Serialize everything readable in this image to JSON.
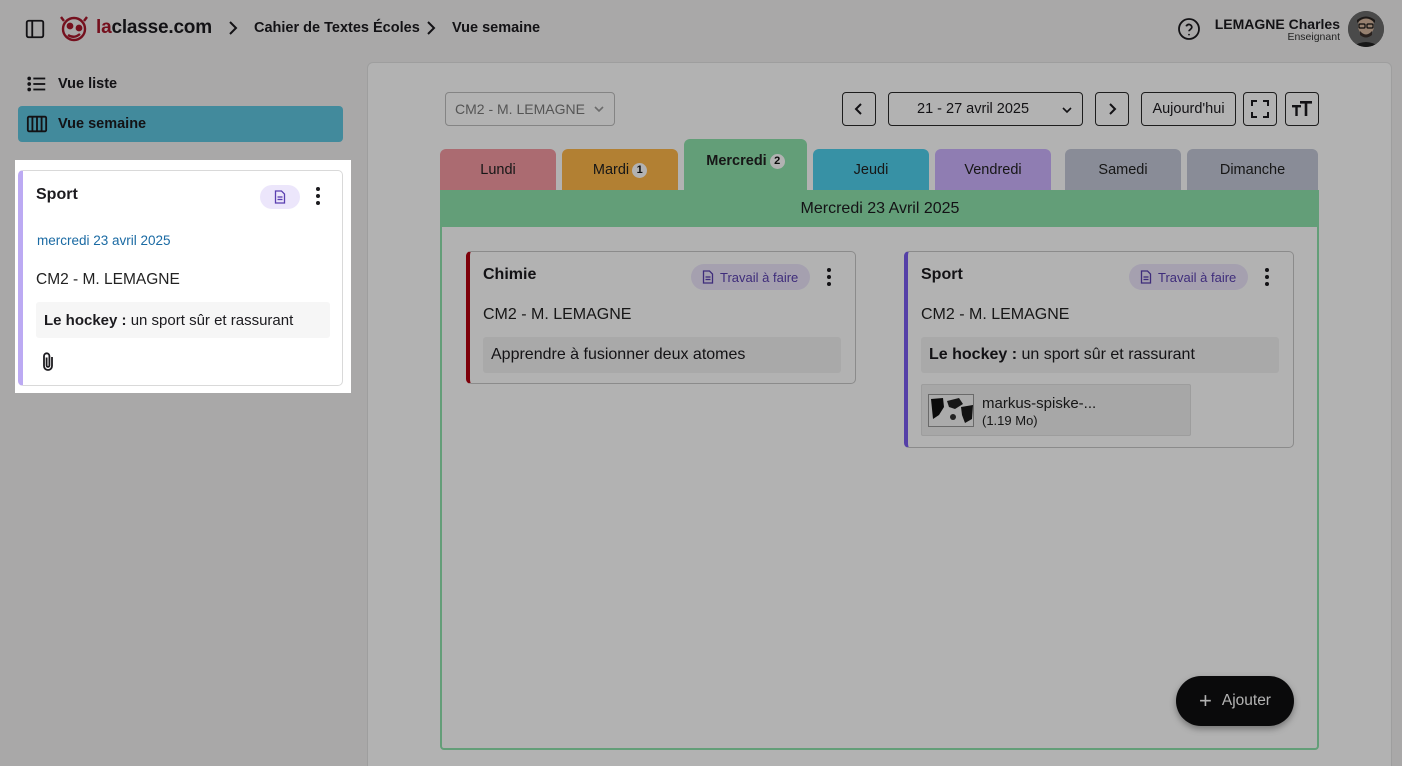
{
  "header": {
    "brand_prefix": "la",
    "brand_suffix": "classe.com",
    "breadcrumb": [
      "Cahier de Textes Écoles",
      "Vue semaine"
    ],
    "user_name": "LEMAGNE Charles",
    "user_role": "Enseignant"
  },
  "sidebar": {
    "items": [
      {
        "label": "Vue liste",
        "icon": "list-icon"
      },
      {
        "label": "Vue semaine",
        "icon": "week-columns-icon",
        "active": true
      }
    ]
  },
  "preview_card": {
    "title": "Sport",
    "date": "mercredi 23 avril 2025",
    "class": "CM2 - M. LEMAGNE",
    "content_bold": "Le hockey :",
    "content_text": " un sport sûr et rassurant",
    "accent_color": "#bcaaf3"
  },
  "toolbar": {
    "class_select": "CM2 - M. LEMAGNE",
    "week_range": "21 - 27 avril 2025",
    "today_label": "Aujourd'hui"
  },
  "days": [
    {
      "label": "Lundi",
      "color": "#f59aa3"
    },
    {
      "label": "Mardi",
      "color": "#ffb84a",
      "badge": "1"
    },
    {
      "label": "Mercredi",
      "color": "#8fe2ac",
      "badge": "2",
      "active": true
    },
    {
      "label": "Jeudi",
      "color": "#4fd0ed"
    },
    {
      "label": "Vendredi",
      "color": "#cdb4ff"
    },
    {
      "label": "Samedi",
      "color": "#c4c9d8"
    },
    {
      "label": "Dimanche",
      "color": "#c4c9d8"
    }
  ],
  "day_header": "Mercredi 23 Avril 2025",
  "lessons": [
    {
      "title": "Chimie",
      "chip": "Travail à faire",
      "class": "CM2 - M. LEMAGNE",
      "content_text": "Apprendre à fusionner deux atomes",
      "accent_color": "#b3000f"
    },
    {
      "title": "Sport",
      "chip": "Travail à faire",
      "class": "CM2 - M. LEMAGNE",
      "content_bold": "Le hockey :",
      "content_text": " un sport sûr et rassurant",
      "accent_color": "#7a5cf0",
      "attachment": {
        "name": "markus-spiske-...",
        "size": "(1.19 Mo)"
      }
    }
  ],
  "fab_label": "Ajouter"
}
